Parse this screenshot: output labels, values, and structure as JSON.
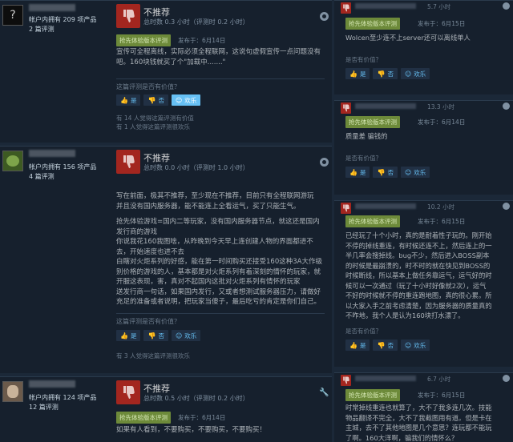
{
  "labels": {
    "not_recommended": "不推荐",
    "early_access": "抢先体验版本评测",
    "helpful_question": "这篇评测是否有价值？",
    "yes": "是",
    "no": "否",
    "funny": "欢乐",
    "r_helpful_question": "是否有价值？"
  },
  "colors": {
    "thumb_down": "#a3261f",
    "early_access_badge": "#6d8a3a",
    "link": "#67c1f5",
    "background": "#1b2838"
  },
  "left_reviews": [
    {
      "avatar": "question-mark",
      "avatar_text": "?",
      "products": "帐户内拥有 209 项产品",
      "reviews": "2 篇评测",
      "hours": "总时数 0.3 小时（评测时 0.2 小时）",
      "posted": "发布于：6月14日",
      "body": [
        "宣传可全程离线，实际必须全程联网，这说句虚假宣传一点问题没有",
        "吧。160块钱就买了个\"加载中.......\""
      ],
      "helpful_count": "有 14 人觉得这篇评测有价值",
      "funny_count": "有 1 人觉得这篇评测很欢乐"
    },
    {
      "avatar": "frog",
      "products": "帐户内拥有 156 项产品",
      "reviews": "4 篇评测",
      "hours": "总时数 0.0 小时（评测时 1.0 小时）",
      "posted": "",
      "body": [
        "写在前面，极其不推荐，至少现在不推荐，目前只有全程联网游玩",
        "并且没有国内服务器，能不能连上全看运气，买了只能生气。",
        "",
        "抢先体验游戏=国内二等玩家，没有国内服务器节点，就这还是国内",
        "发行商的游戏",
        "你说我花160我图啥，从昨晚到今天早上连创建人物的界面都进不",
        "去，开始速度也进不去",
        "白瞎对火炬系列的好感，能在第一时间购买还接受160这种3A大作级",
        "别价格的游戏的人，基本都是对火炬系列有着深刻的情怀的玩家，就",
        "开服这表现，害，真对不起国内这批对火炬系列有情怀的玩家",
        "送发行商一句话，如果国内发行，又或者想测试服务器压力，请做好",
        "充足的准备或者说明，把玩家当傻子，最后吃亏的肯定是你们自己。"
      ],
      "helpful_count": "有 3 人觉得这篇评测很欢乐",
      "funny_count": ""
    },
    {
      "avatar": "picture",
      "products": "帐户内拥有 124 项产品",
      "reviews": "12 篇评测",
      "hours": "总时数 0.5 小时（评测时 0.2 小时）",
      "posted": "发布于：6月14日",
      "body": [
        "如果有人看到，不要购买，不要购买，不要购买！"
      ]
    }
  ],
  "right_reviews": [
    {
      "hours": "5.7 小时",
      "posted": "发布于：6月15日",
      "body": [
        "Wolcen至少连不上server还可以离线单人"
      ]
    },
    {
      "hours": "13.3 小时",
      "posted": "发布于：6月14日",
      "body": [
        "质量差 骗钱的"
      ]
    },
    {
      "hours": "10.2 小时",
      "posted": "发布于：6月15日",
      "body": [
        "已经玩了十个小时，真的是耐着性子玩的。刚开始",
        "不停的掉线重连，有时候还连不上，然后连上的一",
        "半几率会搜掉线。bug不少，然后进入BOSS副本",
        "的时候是最崩溃的，时不时的就在快见到BOSS的",
        "时候断线，所以基本上做任务靠运气，运气好的时",
        "候可以一次通过（玩了十小时好像就2次），运气",
        "不好的时候就不停的重连跑地图，真的很心累。所",
        "以大家入手之前考虑清楚，因为服务器的质量真的",
        "不咋地，我个人是认为160块打水漂了。"
      ]
    },
    {
      "hours": "6.7 小时",
      "posted": "发布于：6月15日",
      "body": [
        "时常掉线重连也就算了，大不了我多连几次。技能",
        "物品翻译不完全，大不了我截图用有道。但是卡在",
        "主城，去不了其他地图是几个意思？连玩都不能玩",
        "了啊。160大洋啊，骗我们的情怀么？"
      ]
    }
  ]
}
